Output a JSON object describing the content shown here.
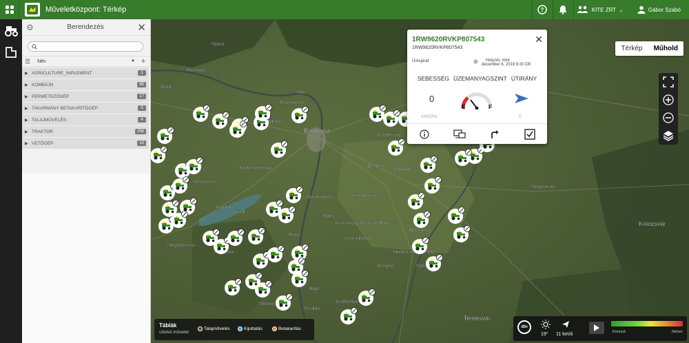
{
  "header": {
    "title": "Műveletközpont: Térkép",
    "organization": "KITE ZRT",
    "user": "Gábor Szabó"
  },
  "panel": {
    "title": "Berendezés",
    "search_placeholder": "",
    "column_name": "Név",
    "categories": [
      {
        "name": "AGRICULTURE_IMPLEMENT",
        "count": "1"
      },
      {
        "name": "KOMBÁJN",
        "count": "95"
      },
      {
        "name": "PERMETEZŐGÉP",
        "count": "17"
      },
      {
        "name": "TAKARMÁNY BETAKARÍTÓGÉP",
        "count": "5"
      },
      {
        "name": "TALAJMŰVELÉS",
        "count": "4"
      },
      {
        "name": "TRAKTOR",
        "count": "258"
      },
      {
        "name": "VETŐGÉP",
        "count": "10"
      }
    ]
  },
  "map": {
    "type_map": "Térkép",
    "type_satellite": "Műhold",
    "labels": [
      "Pozsony",
      "Budapest",
      "Kecskemét",
      "Szeged",
      "Kaposvár",
      "Pécs",
      "Székesfehérvár",
      "Siófok",
      "Szolnok",
      "Cegléd",
      "Orosháza",
      "Hódmezővásárhely",
      "Makó",
      "Temesvár",
      "Kolozsvár",
      "Nagyvárad",
      "Nagykanizsa",
      "Veszprém",
      "Baja",
      "Szabadka",
      "Zombor",
      "Jászberény",
      "Mohács",
      "Kiskunhalas",
      "Paks",
      "Nyitra",
      "Vác",
      "Gyöngyös",
      "Dunaújváros",
      "Győr",
      "Tatabánya",
      "Esztergom",
      "Kiskunsági Nemzeti Park",
      "Balaton"
    ]
  },
  "popup": {
    "vehicle_id": "1RW9620RVKP807543",
    "vehicle_id_sub": "1RW9620RVKP807543",
    "status": "Üresjárat",
    "position_line1": "Helyzet, mint",
    "position_line2": "december 6, 2019 8:30 DE",
    "head_speed": "SEBESSÉG",
    "head_fuel": "ÜZEMANYAGSZINT",
    "head_dir": "ÚTIRÁNY",
    "speed_value": "0",
    "speed_unit": "KM/ÓRA",
    "fuel_e": "E",
    "fuel_f": "F",
    "dir_unit": "K"
  },
  "legend": {
    "title": "Táblák",
    "subtitle": "Utolsó művelet",
    "items": [
      {
        "label": "Talajművelés",
        "color": "#6b4a1e"
      },
      {
        "label": "Kijuttatás",
        "color": "#3aa0e8"
      },
      {
        "label": "Betakarítás",
        "color": "#e8862e"
      }
    ]
  },
  "weather": {
    "logo": "dtn",
    "temp": "19°",
    "wind": "11 km/ó",
    "light": "Könnyű",
    "heavy": "Nehéz"
  },
  "colors": {
    "brand_green": "#367c2b",
    "marker_green": "#3d8a2a"
  }
}
